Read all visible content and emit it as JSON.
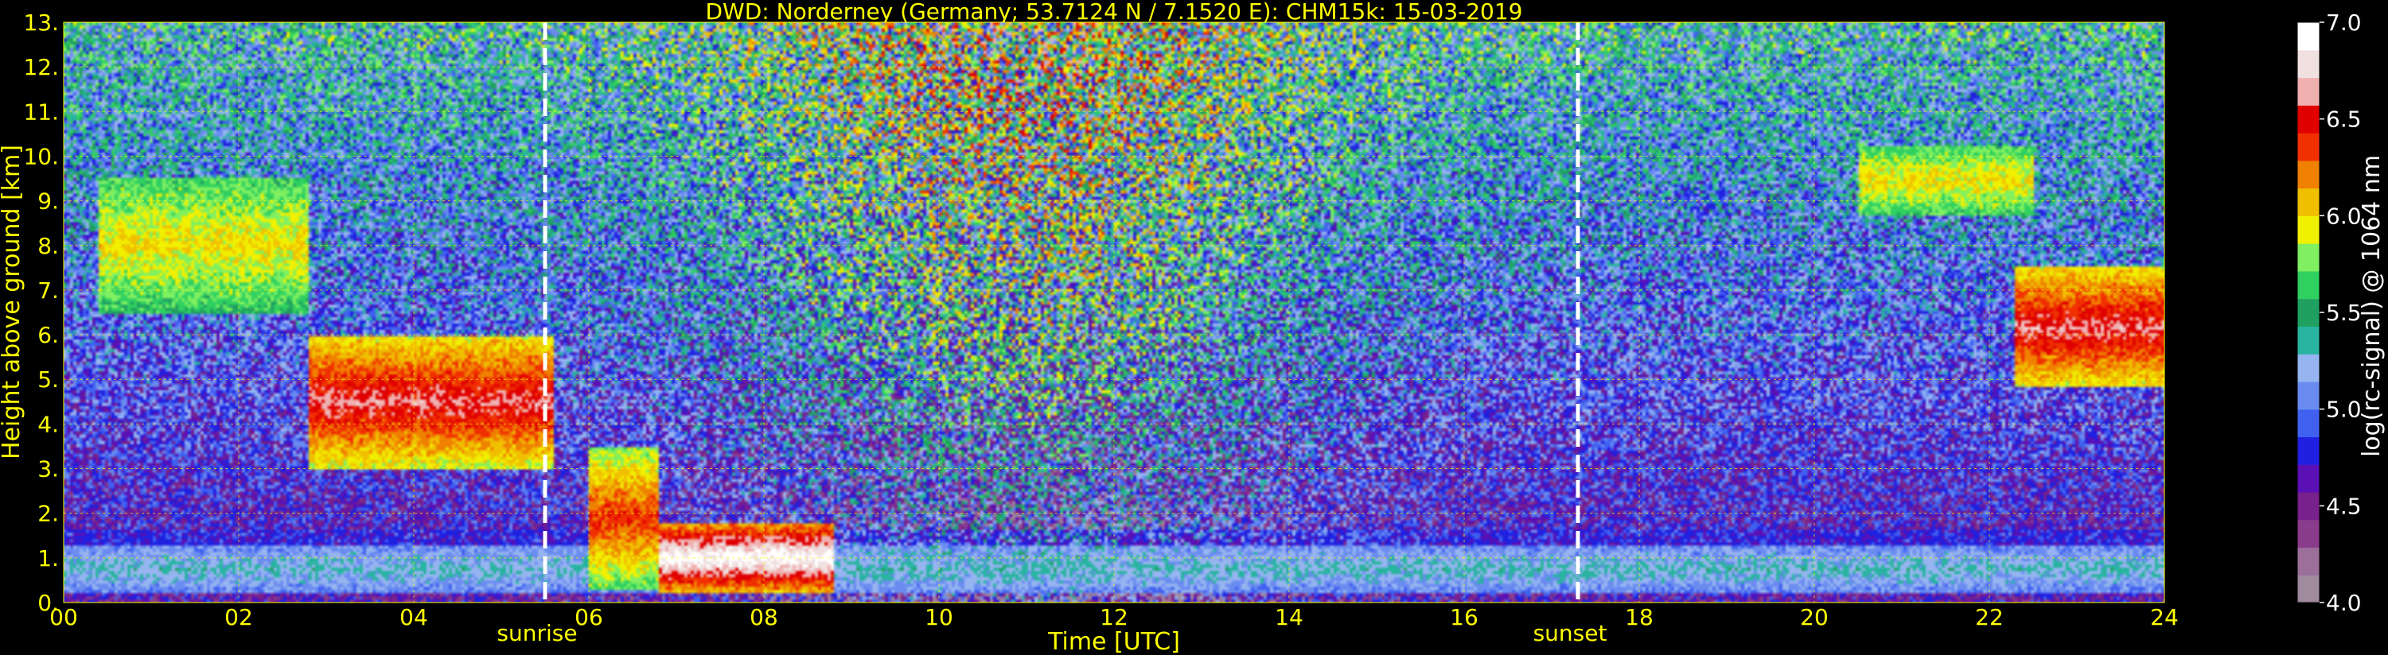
{
  "chart_data": {
    "type": "heatmap",
    "title": "DWD: Norderney (Germany; 53.7124 N / 7.1520 E):    CHM15k: 15-03-2019",
    "xlabel": "Time [UTC]",
    "ylabel": "Height above ground [km]",
    "colorbar_label": "log(rc-signal) @ 1064 nm",
    "xlim": [
      0,
      24
    ],
    "ylim": [
      0,
      13
    ],
    "clim": [
      4.0,
      7.0
    ],
    "x_ticks": [
      "00",
      "02",
      "04",
      "06",
      "08",
      "10",
      "12",
      "14",
      "16",
      "18",
      "20",
      "22",
      "24"
    ],
    "y_ticks": [
      "0.",
      "1.",
      "2.",
      "3.",
      "4.",
      "5.",
      "6.",
      "7.",
      "8.",
      "9.",
      "10.",
      "11.",
      "12.",
      "13."
    ],
    "colorbar_ticks": [
      "4.0",
      "4.5",
      "5.0",
      "5.5",
      "6.0",
      "6.5",
      "7.0"
    ],
    "grid": true,
    "markers": [
      {
        "label": "sunrise",
        "time": 5.5
      },
      {
        "label": "sunset",
        "time": 17.3
      }
    ],
    "layers": [
      {
        "feature": "boundary layer aerosol",
        "time": [
          0,
          24
        ],
        "height_km": [
          0.2,
          1.3
        ],
        "log_signal": 5.3
      },
      {
        "feature": "aerosol top layer",
        "time": [
          0,
          24
        ],
        "height_km": [
          1.0,
          1.6
        ],
        "log_signal": 4.7
      },
      {
        "feature": "cloud",
        "time": [
          0.4,
          2.8
        ],
        "height_km": [
          6.5,
          9.5
        ],
        "log_signal": 6.0
      },
      {
        "feature": "cloud",
        "time": [
          2.8,
          5.6
        ],
        "height_km": [
          3.0,
          6.0
        ],
        "log_signal": 6.6
      },
      {
        "feature": "cloud",
        "time": [
          6.0,
          6.8
        ],
        "height_km": [
          0.3,
          3.5
        ],
        "log_signal": 6.4
      },
      {
        "feature": "cloud",
        "time": [
          6.8,
          8.8
        ],
        "height_km": [
          0.2,
          1.8
        ],
        "log_signal": 7.0
      },
      {
        "feature": "cloud",
        "time": [
          20.5,
          22.5
        ],
        "height_km": [
          8.7,
          10.2
        ],
        "log_signal": 6.0
      },
      {
        "feature": "cloud",
        "time": [
          22.3,
          24.0
        ],
        "height_km": [
          4.8,
          7.5
        ],
        "log_signal": 6.6
      }
    ]
  },
  "colors": {
    "background": "#000000",
    "text": "#ffff00",
    "grid": "#ffff00",
    "marker": "#ffffff",
    "colormap": [
      "#a08a9e",
      "#9c6f9b",
      "#8a3c8c",
      "#78208c",
      "#5a10b4",
      "#2020e0",
      "#4060f0",
      "#6a8cf0",
      "#96b4f0",
      "#28b4a0",
      "#20a060",
      "#30d060",
      "#80f060",
      "#f0f000",
      "#f0c000",
      "#f08000",
      "#f03000",
      "#e00000",
      "#f0b0b0",
      "#f0e0e0",
      "#ffffff"
    ]
  }
}
